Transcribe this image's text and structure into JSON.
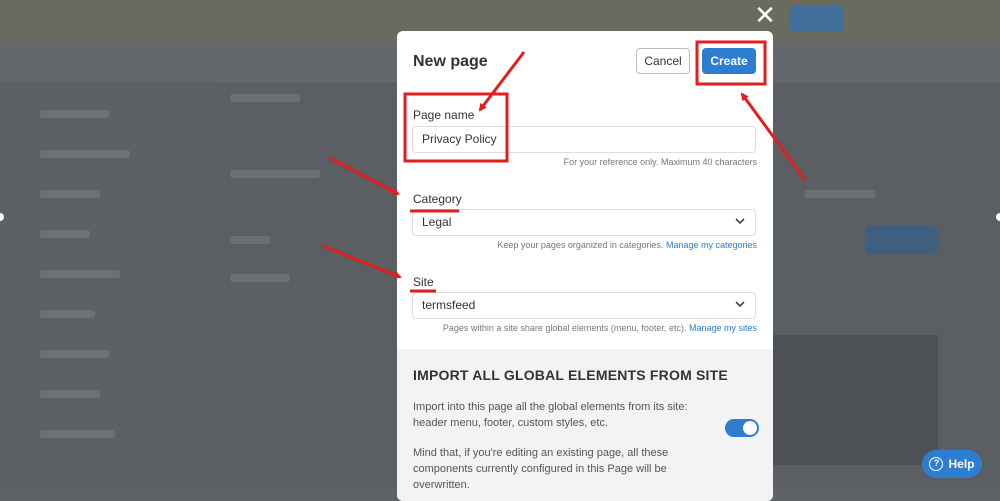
{
  "modal": {
    "title": "New page",
    "cancel_label": "Cancel",
    "create_label": "Create",
    "page_name": {
      "label": "Page name",
      "value": "Privacy Policy",
      "help": "For your reference only. Maximum 40 characters"
    },
    "category": {
      "label": "Category",
      "value": "Legal",
      "help": "Keep your pages organized in categories.",
      "link": "Manage my categories"
    },
    "site": {
      "label": "Site",
      "value": "termsfeed",
      "help": "Pages within a site share global elements (menu, footer, etc).",
      "link": "Manage my sites"
    },
    "import": {
      "title": "IMPORT ALL GLOBAL ELEMENTS FROM SITE",
      "text1": "Import into this page all the global elements from its site: header menu, footer, custom styles, etc.",
      "text2": "Mind that, if you're editing an existing page, all these components currently configured in this Page will be overwritten.",
      "toggle_on": true
    }
  },
  "help_button": {
    "label": "Help"
  },
  "icons": {
    "close": "close-icon",
    "chevron": "chevron-down-icon",
    "help": "help-icon"
  },
  "colors": {
    "accent": "#2d7ed1",
    "annotation": "#e31e1e",
    "overlay": "#5f6266"
  }
}
